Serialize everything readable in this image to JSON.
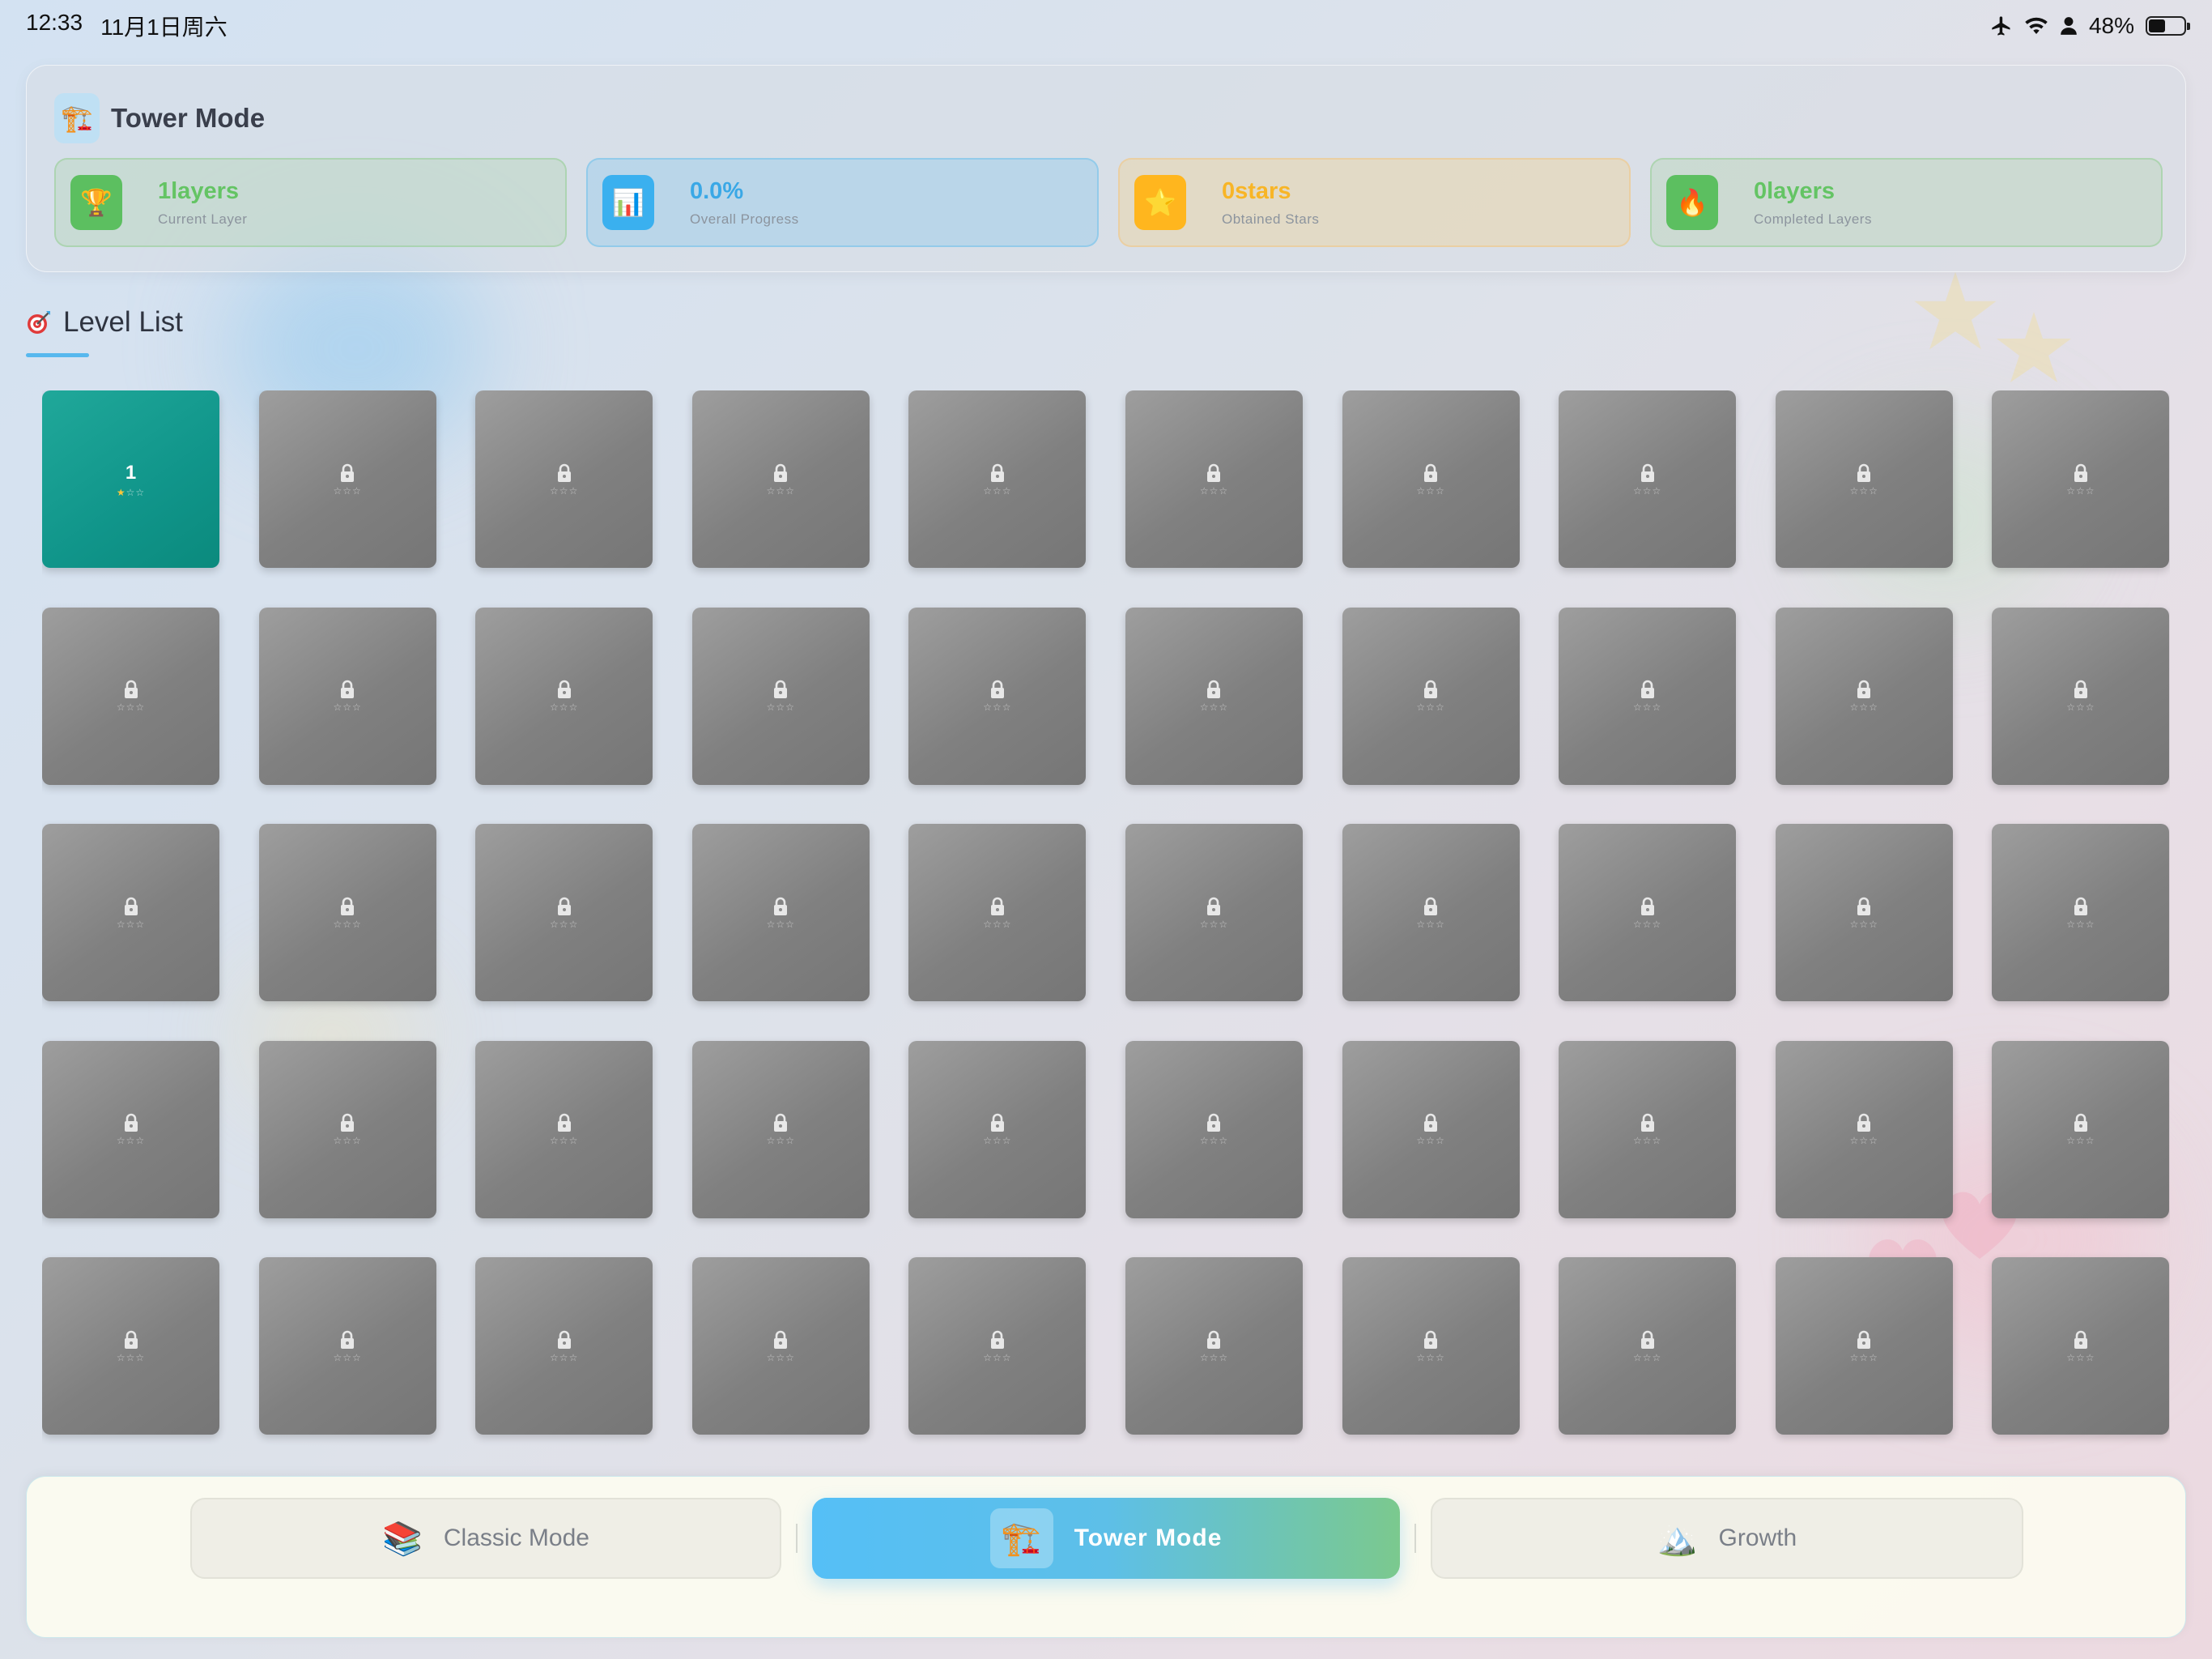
{
  "status_bar": {
    "time": "12:33",
    "date": "11月1日周六",
    "battery": "48%",
    "battery_level": 0.48,
    "icons": [
      "airplane-icon",
      "wifi-icon",
      "person-icon",
      "battery-icon"
    ]
  },
  "header": {
    "title": "Tower Mode",
    "icon": "crane-icon",
    "stats": [
      {
        "value": "1layers",
        "label": "Current Layer",
        "icon": "trophy-icon",
        "color": "#5cbf60"
      },
      {
        "value": "0.0%",
        "label": "Overall Progress",
        "icon": "bar-chart-icon",
        "color": "#3ab0ef"
      },
      {
        "value": "0stars",
        "label": "Obtained Stars",
        "icon": "star-icon",
        "color": "#ffb61e"
      },
      {
        "value": "0layers",
        "label": "Completed Layers",
        "icon": "fire-icon",
        "color": "#5cbf60"
      }
    ]
  },
  "level_list": {
    "title": "Level List",
    "icon": "target-icon",
    "accent_color": "#57b8ee",
    "unlocked_color": "#13998b",
    "locked_color": "#8a8a8a",
    "levels": [
      {
        "number": "1",
        "unlocked": true,
        "stars_earned": 1
      }
    ],
    "locked_count": 49,
    "stars_per_level": 3
  },
  "bottom_nav": {
    "items": [
      {
        "label": "Classic Mode",
        "icon": "books-icon",
        "active": false
      },
      {
        "label": "Tower Mode",
        "icon": "crane-icon",
        "active": true
      },
      {
        "label": "Growth",
        "icon": "mountain-icon",
        "active": false
      }
    ]
  }
}
